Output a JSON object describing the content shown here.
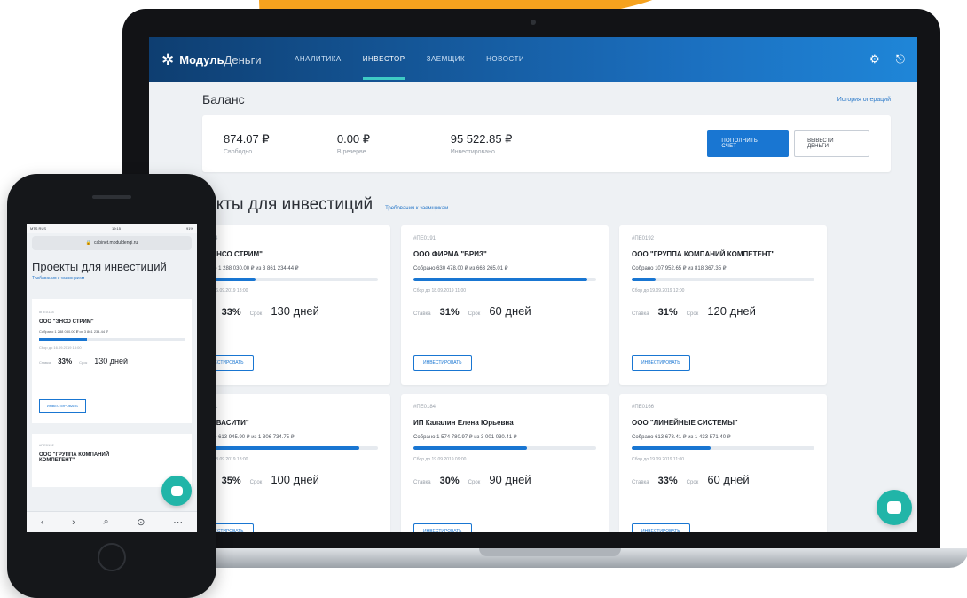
{
  "app": {
    "logo_bold": "Модуль",
    "logo_light": "Деньги"
  },
  "nav": [
    {
      "label": "АНАЛИТИКА",
      "active": false
    },
    {
      "label": "ИНВЕСТОР",
      "active": true
    },
    {
      "label": "ЗАЕМЩИК",
      "active": false
    },
    {
      "label": "НОВОСТИ",
      "active": false
    }
  ],
  "header_icons": {
    "settings": "⚙",
    "logout": "⎋"
  },
  "balance": {
    "title": "Баланс",
    "history_link": "История операций",
    "items": [
      {
        "value": "874.07 ₽",
        "label": "Свободно"
      },
      {
        "value": "0.00 ₽",
        "label": "В резерве"
      },
      {
        "value": "95 522.85 ₽",
        "label": "Инвестировано"
      }
    ],
    "topup_button": "ПОПОЛНИТЬ СЧЕТ",
    "withdraw_button": "ВЫВЕСТИ ДЕНЬГИ"
  },
  "projects": {
    "title": "роекты для инвестиций",
    "link": "Требования к заемщикам",
    "cards": [
      {
        "id": "#ОЕ0134",
        "name": "ОО \"ЭНСО СТРИМ\"",
        "collected": "Собрано 1 288 030.00 ₽ из 3 861 234.44 ₽",
        "progress": 0.33,
        "deadline": "Сбор до 16.09.2019 18:00",
        "rate": "33%",
        "term": "130 дней",
        "button": "ИНВЕСТИРОВАТЬ"
      },
      {
        "id": "#ПЕ0191",
        "name": "ООО ФИРМА \"БРИЗ\"",
        "collected": "Собрано 630 478.00 ₽ из 663 265.01 ₽",
        "progress": 0.95,
        "deadline": "Сбор до 18.09.2019 11:00",
        "rate": "31%",
        "term": "60 дней",
        "button": "ИНВЕСТИРОВАТЬ"
      },
      {
        "id": "#ПЕ0192",
        "name": "ООО \"ГРУППА КОМПАНИЙ КОМПЕТЕНТ\"",
        "collected": "Собрано 107 952.65 ₽ из 818 367.35 ₽",
        "progress": 0.13,
        "deadline": "Сбор до 19.09.2019 12:00",
        "rate": "31%",
        "term": "120 дней",
        "button": "ИНВЕСТИРОВАТЬ"
      },
      {
        "id": "#ОЕ0171",
        "name": "О \"ВИВАСИТИ\"",
        "collected": "Собрано 613 945.90 ₽ из 1 306 734.75 ₽",
        "progress": 0.9,
        "deadline": "Сбор до 18.09.2019 18:00",
        "rate": "35%",
        "term": "100 дней",
        "button": "ИНВЕСТИРОВАТЬ"
      },
      {
        "id": "#ПЕ0184",
        "name": "ИП Калалин Елена Юрьевна",
        "collected": "Собрано 1 574 780.97 ₽ из 3 001 030.41 ₽",
        "progress": 0.62,
        "deadline": "Сбор до 19.09.2019 09:00",
        "rate": "30%",
        "term": "90 дней",
        "button": "ИНВЕСТИРОВАТЬ"
      },
      {
        "id": "#ПЕ0166",
        "name": "ООО \"ЛИНЕЙНЫЕ СИСТЕМЫ\"",
        "collected": "Собрано 613 678.41 ₽ из 1 433 571.40 ₽",
        "progress": 0.43,
        "deadline": "Сбор до 19.09.2019 11:00",
        "rate": "33%",
        "term": "60 дней",
        "button": "ИНВЕСТИРОВАТЬ"
      }
    ]
  },
  "labels": {
    "rate": "Ставка",
    "term": "Срок"
  },
  "mobile": {
    "status_left": "MTS RUS",
    "status_center": "19:15",
    "status_right": "91%",
    "url": "cabinet.moduldengi.ru",
    "title": "Проекты для инвестиций",
    "link": "Требования к заемщикам",
    "card": {
      "id": "#ПЕ0134",
      "name": "ООО \"ЭНСО СТРИМ\"",
      "collected": "Собрано 1 288 030.00 ₽ из 3 861 234.44 ₽",
      "progress": 0.33,
      "deadline": "Сбор до 16.09.2019 18:00",
      "rate": "33%",
      "term": "130 дней",
      "button": "ИНВЕСТИРОВАТЬ"
    },
    "card2": {
      "id": "#ПЕ0192",
      "name": "ООО \"ГРУППА КОМПАНИЙ КОМПЕТЕНТ\""
    },
    "nav_icons": [
      "‹",
      "›",
      "⌕",
      "⊙",
      "⋯"
    ]
  },
  "colors": {
    "primary": "#1976d2",
    "header_start": "#0e3e71",
    "header_end": "#1f86d8",
    "accent_teal": "#21b5a8",
    "orange": "#f6a21e"
  }
}
